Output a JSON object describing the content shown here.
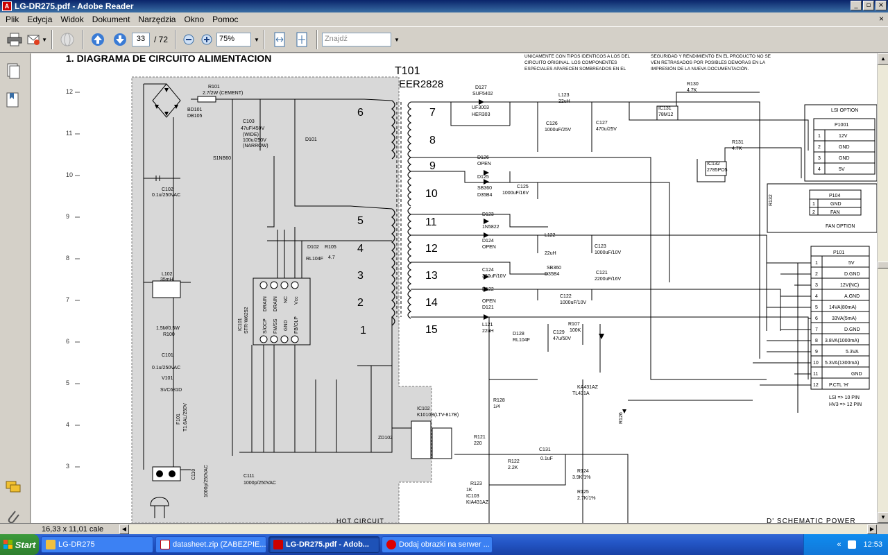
{
  "window": {
    "title": "LG-DR275.pdf - Adobe Reader",
    "buttons": {
      "minimize": "_",
      "restore": "▫",
      "close": "×"
    }
  },
  "menu": [
    "Plik",
    "Edycja",
    "Widok",
    "Dokument",
    "Narzędzia",
    "Okno",
    "Pomoc"
  ],
  "menu_close": "×",
  "toolbar": {
    "page_current": "33",
    "page_total": "/ 72",
    "zoom": "75%",
    "find_placeholder": "Znajdź"
  },
  "status": {
    "page_size": "16,33 x 11,01 cale"
  },
  "document": {
    "heading": "1. DIAGRAMA DE CIRCUITO ALIMENTACION",
    "note_left": [
      "UNICAMENTE CON TIPOS IDENTICOS A LOS DEL",
      "CIRCUITO ORIGINAL. LOS COMPONENTES",
      "ESPECIALES APARECEN SOMBREADOS EN EL"
    ],
    "note_right": [
      "SEGURIDAD Y RENDIMIENTO EN EL PRODUCTO NO SE",
      "VEN RETRASADOS POR POSIBLES DEMORAS EN LA",
      "IMPRESIÓN DE LA NUEVA DOCUMENTACIÓN."
    ],
    "ruler_numbers": [
      "12",
      "11",
      "10",
      "9",
      "8",
      "7",
      "6",
      "5",
      "4",
      "3"
    ],
    "transformer": "T101",
    "transformer_type": "EER2828",
    "hot_label": "HOT CIRCUIT",
    "footer_label": "D' SCHEMATIC POWER",
    "winding_primary": [
      "6",
      "5",
      "4",
      "3",
      "2",
      "1"
    ],
    "winding_secondary": [
      "7",
      "8",
      "9",
      "10",
      "11",
      "12",
      "13",
      "14",
      "15"
    ],
    "ic101": {
      "name": "IC101",
      "part": "STR-W6252",
      "top_pins": [
        "DRAIN",
        "DRAIN",
        "NC",
        "Vcc"
      ],
      "bottom_pins": [
        "S/OCP",
        "FM/SS",
        "GND",
        "FB/OLP"
      ]
    },
    "primary_labels": [
      "R101",
      "2.7/2W (CEMENT)",
      "BD101",
      "DB105",
      "C103",
      "47uF/450V",
      "(WIDE)",
      "100u/250V",
      "(NARROW)",
      "S1NB60",
      "C102",
      "0.1u/250VAC",
      "L102",
      "35mH",
      "1.5M/0.5W",
      "R100",
      "C101",
      "0.1u/250VAC",
      "V101",
      "SVC681D",
      "F101",
      "T1.6AL/250V",
      "C110",
      "1000p/250VAC",
      "C111",
      "1000p/250VAC",
      "D102",
      "RL104F",
      "R105",
      "4.7",
      "D101",
      "ZD102",
      "IC102",
      "K1010B(LTV-817B)"
    ],
    "secondary_labels": [
      "D127",
      "SUF5402",
      "UF3003",
      "HER303",
      "C126",
      "1000uF/25V",
      "L123",
      "22uH",
      "C127",
      "470u/25V",
      "IC131",
      "78M12",
      "R130",
      "4.7K",
      "D126",
      "OPEN",
      "D125",
      "SB360",
      "D35B4",
      "C125",
      "1000uF/16V",
      "IC132",
      "2785PO5",
      "R131",
      "4.7K",
      "D123",
      "1N5822",
      "D124",
      "OPEN",
      "L122",
      "22uH",
      "C123",
      "1000uF/10V",
      "C124",
      "330uF/10V",
      "D122",
      "OPEN",
      "D121",
      "SB360",
      "D35B4",
      "C121",
      "2200uF/16V",
      "C122",
      "1000uF/10V",
      "L121",
      "22uH",
      "D128",
      "RL104F",
      "C129",
      "47u/50V",
      "R107",
      "100K",
      "R128",
      "1/4",
      "R121",
      "220",
      "R122",
      "2.2K",
      "C131",
      "0.1uF",
      "R123",
      "1K",
      "IC103",
      "KIA431AZ",
      "KA431AZ",
      "TL431A",
      "R124",
      "3.9K/1%",
      "R125",
      "2.7K/1%",
      "R126",
      "270",
      "D131"
    ],
    "lsi_option": {
      "title": "LSI OPTION",
      "connector": "P1001",
      "rows": [
        [
          "1",
          "12V"
        ],
        [
          "2",
          "GND"
        ],
        [
          "3",
          "GND"
        ],
        [
          "4",
          "5V"
        ]
      ]
    },
    "fan_option": {
      "title": "FAN OPTION",
      "connector": "P104",
      "rows": [
        [
          "1",
          "GND"
        ],
        [
          "2",
          "FAN"
        ]
      ],
      "resistor": "R132"
    },
    "p101": {
      "connector": "P101",
      "rows": [
        [
          "1",
          "5V"
        ],
        [
          "2",
          "D.GND"
        ],
        [
          "3",
          "12V(NC)"
        ],
        [
          "4",
          "A.GND"
        ],
        [
          "5",
          "14VA(80mA)"
        ],
        [
          "6",
          "33VA(5mA)"
        ],
        [
          "7",
          "D.GND"
        ],
        [
          "8",
          "3.8VA(1000mA)"
        ],
        [
          "9",
          "5.3VA"
        ],
        [
          "10",
          "5.3VA(1300mA)"
        ],
        [
          "11",
          "GND"
        ],
        [
          "12",
          "P.CTL 'H'"
        ]
      ],
      "notes": [
        "LSI => 10 PIN",
        "HV3 => 12 PIN"
      ]
    }
  },
  "taskbar": {
    "start": "Start",
    "tasks": [
      {
        "label": "LG-DR275",
        "active": false
      },
      {
        "label": "datasheet.zip (ZABEZPIE...",
        "active": false
      },
      {
        "label": "LG-DR275.pdf - Adob...",
        "active": true
      },
      {
        "label": "Dodaj obrazki na serwer ...",
        "active": false
      }
    ],
    "lang": "PL",
    "clock": "12:53",
    "tray_chevron": "«"
  },
  "colors": {
    "title_bar": "#0a246a",
    "shaded_region": "#d8d8d8",
    "taskbar": "#2456c6",
    "start": "#3c9a3c"
  }
}
